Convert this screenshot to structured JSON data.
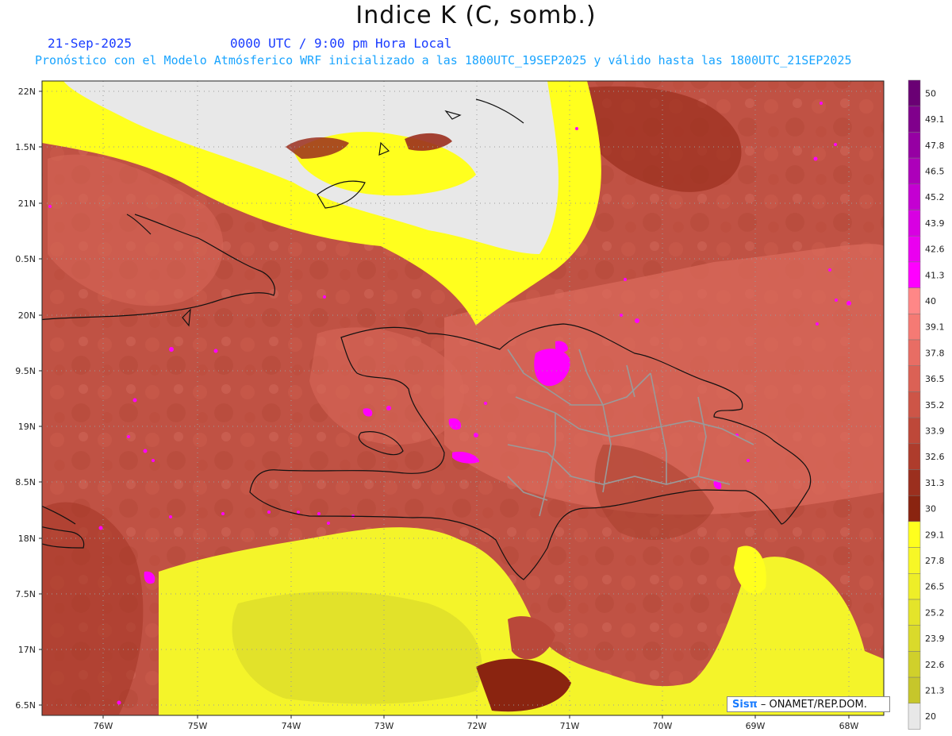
{
  "header": {
    "title": "Indice K (C, somb.)",
    "date": "21-Sep-2025",
    "time": "0000 UTC / 9:00 pm Hora Local",
    "description": "Pronóstico con el Modelo Atmósferico WRF inicializado a las 1800UTC_19SEP2025 y válido hasta las  1800UTC_21SEP2025"
  },
  "map": {
    "lat_labels": [
      "22N",
      "1.5N",
      "21N",
      "0.5N",
      "20N",
      "9.5N",
      "19N",
      "8.5N",
      "18N",
      "7.5N",
      "17N",
      "6.5N"
    ],
    "lon_labels": [
      "76W",
      "75W",
      "74W",
      "73W",
      "72W",
      "71W",
      "70W",
      "69W",
      "68W"
    ],
    "land_label_color": "#ff00ff"
  },
  "colorbar": {
    "labels": [
      "50",
      "49.1",
      "47.8",
      "46.5",
      "45.2",
      "43.9",
      "42.6",
      "41.3",
      "40",
      "39.1",
      "37.8",
      "36.5",
      "35.2",
      "33.9",
      "32.6",
      "31.3",
      "30",
      "29.1",
      "27.8",
      "26.5",
      "25.2",
      "23.9",
      "22.6",
      "21.3",
      "20"
    ],
    "colors": [
      "#6a0074",
      "#80008c",
      "#9600a3",
      "#ad00ba",
      "#c400d2",
      "#d800e2",
      "#ea00f0",
      "#ff00ff",
      "#ff8787",
      "#f57a74",
      "#e86d64",
      "#db6155",
      "#cd5547",
      "#be4839",
      "#ae3c2c",
      "#9b2f1e",
      "#8a2410",
      "#ffff1e",
      "#f7f726",
      "#eeee28",
      "#e4e42a",
      "#dada2b",
      "#d0d02b",
      "#c6c62b",
      "#e8e8e8"
    ]
  },
  "credit": {
    "brand": "Sisπ",
    "text": "– ONAMET/REP.DOM."
  }
}
